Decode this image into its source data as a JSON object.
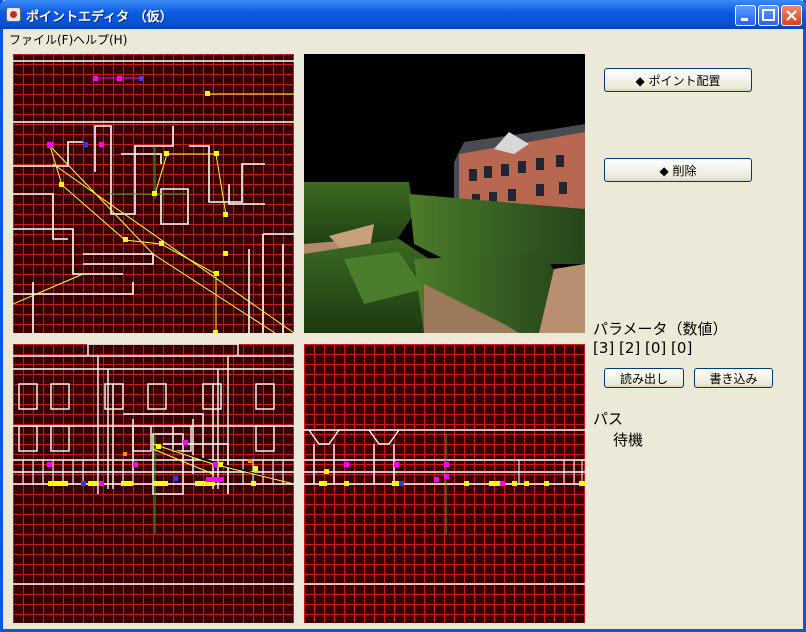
{
  "window": {
    "title": "ポイントエディタ （仮）"
  },
  "menu": {
    "file": "ファイル(F)",
    "help": "ヘルプ(H)"
  },
  "buttons": {
    "place_point": "◆ ポイント配置",
    "delete": "◆ 削除",
    "read": "読み出し",
    "write": "書き込み"
  },
  "params": {
    "title": "パラメータ（数値）",
    "values": "[3] [2] [0] [0]"
  },
  "path": {
    "title": "パス",
    "value": "待機"
  },
  "colors": {
    "grid": "#c41c1c",
    "grid_bg": "#3a0000",
    "titlebar": "#0a5ae0",
    "panel": "#ece9d8"
  }
}
